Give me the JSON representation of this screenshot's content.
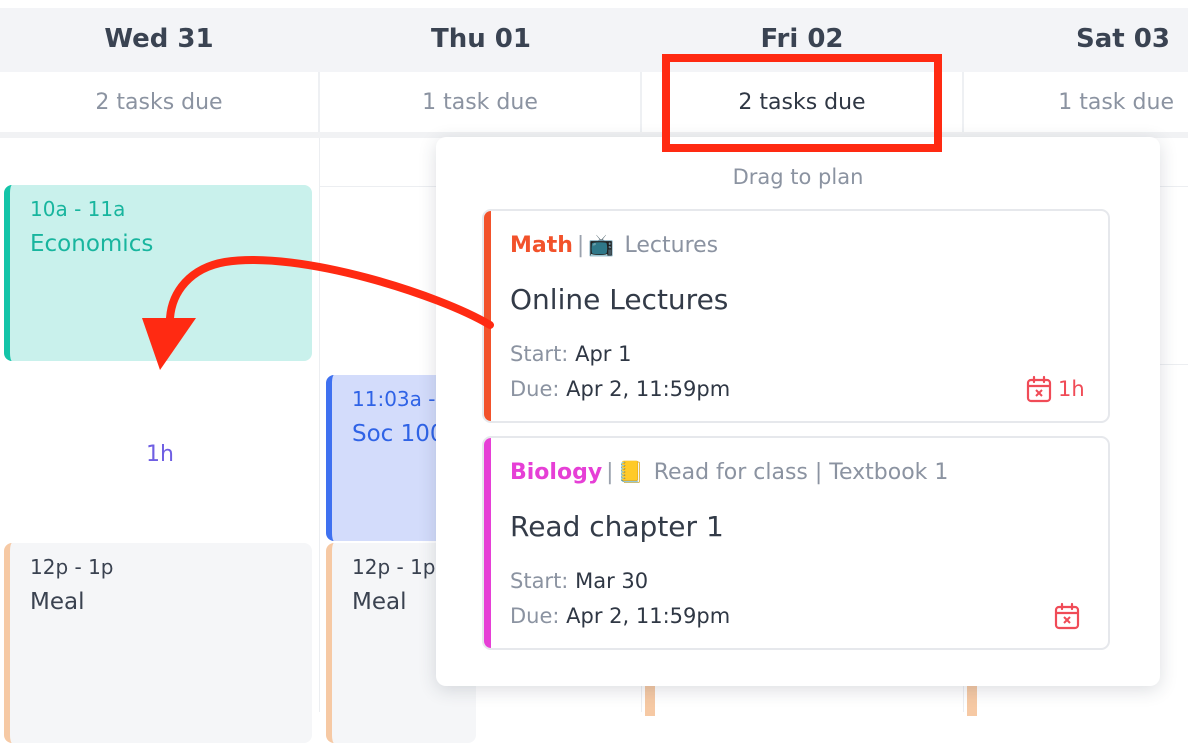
{
  "days": [
    {
      "label": "Wed 31",
      "due": "2 tasks due"
    },
    {
      "label": "Thu 01",
      "due": "1 task due"
    },
    {
      "label": "Fri 02",
      "due": "2 tasks due"
    },
    {
      "label": "Sat 03",
      "due": "1 task due"
    }
  ],
  "events": {
    "economics": {
      "time": "10a - 11a",
      "title": "Economics"
    },
    "soc": {
      "time": "11:03a -",
      "title": "Soc 100"
    },
    "meal_wed": {
      "time": "12p - 1p",
      "title": "Meal"
    },
    "meal_thu": {
      "time": "12p - 1p",
      "title": "Meal"
    },
    "gap_label": "1h"
  },
  "popover": {
    "hint": "Drag to plan",
    "tasks": [
      {
        "subject": "Math",
        "emoji": "📺",
        "type": "Lectures",
        "title": "Online Lectures",
        "start_label": "Start:",
        "start": "Apr 1",
        "due_label": "Due:",
        "due": "Apr 2, 11:59pm",
        "duration": "1h"
      },
      {
        "subject": "Biology",
        "emoji": "📒",
        "type": "Read for class | Textbook 1",
        "title": "Read chapter 1",
        "start_label": "Start:",
        "start": "Mar 30",
        "due_label": "Due:",
        "due": "Apr 2, 11:59pm"
      }
    ]
  },
  "colors": {
    "math": "#f2522b",
    "biology": "#e63fd6",
    "economics": "#14c4a8",
    "soc": "#3f71f0",
    "meal": "#f6c9a4",
    "annotation": "#ff2a12"
  }
}
